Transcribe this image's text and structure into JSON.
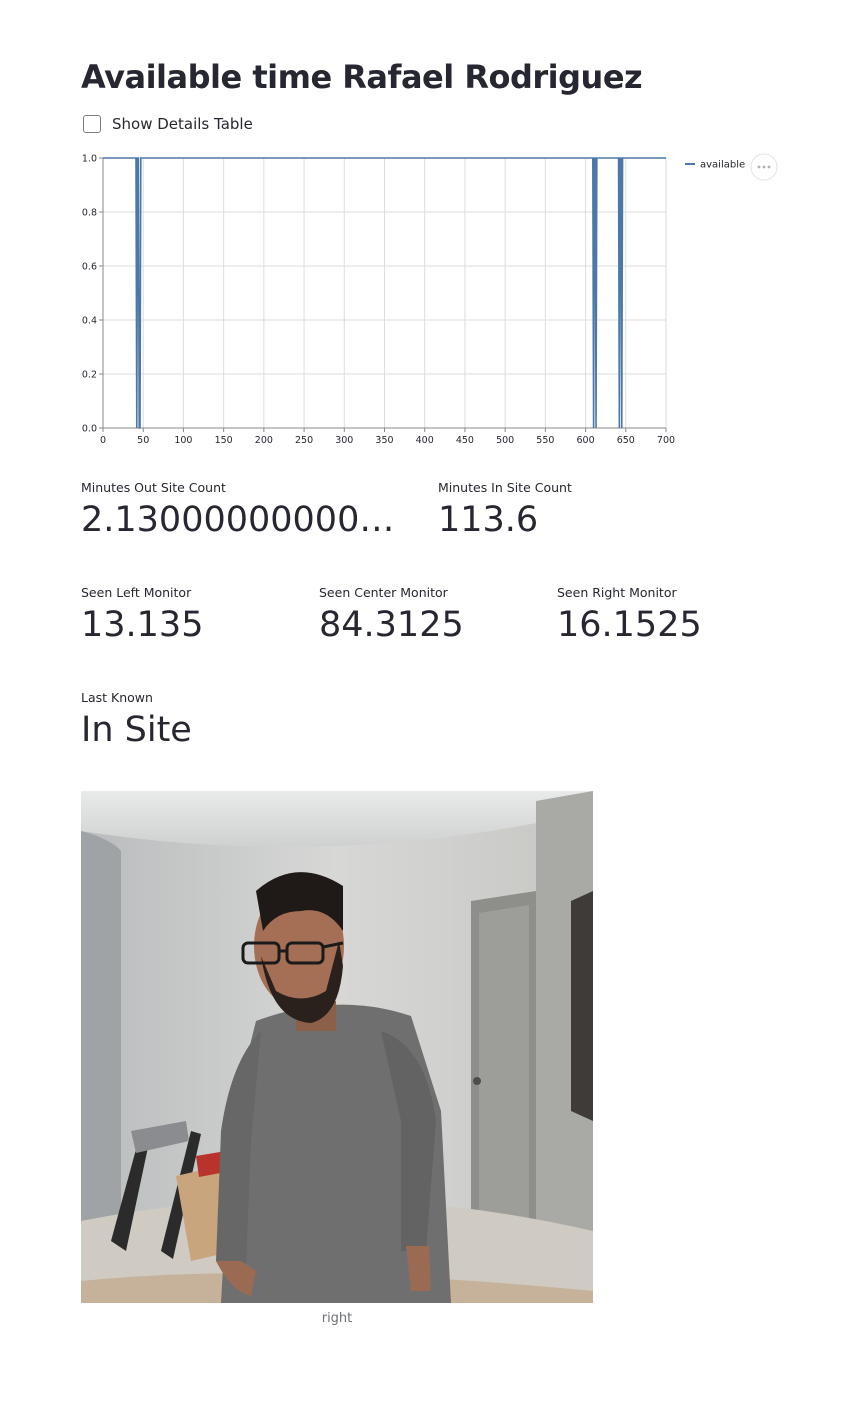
{
  "page": {
    "title": "Available time Rafael Rodriguez"
  },
  "controls": {
    "show_details_label": "Show Details Table",
    "show_details_checked": false
  },
  "chart_data": {
    "type": "line",
    "series": [
      {
        "name": "available",
        "color": "#4c78a8",
        "points": [
          [
            0,
            1
          ],
          [
            41,
            1
          ],
          [
            42,
            0
          ],
          [
            43,
            1
          ],
          [
            44,
            1
          ],
          [
            45,
            0
          ],
          [
            46,
            0
          ],
          [
            47,
            1
          ],
          [
            609,
            1
          ],
          [
            610,
            0
          ],
          [
            611,
            1
          ],
          [
            612,
            1
          ],
          [
            613,
            0
          ],
          [
            614,
            1
          ],
          [
            641,
            1
          ],
          [
            642,
            0
          ],
          [
            643,
            1
          ],
          [
            644,
            1
          ],
          [
            645,
            0
          ],
          [
            646,
            1
          ],
          [
            700,
            1
          ]
        ]
      }
    ],
    "x_ticks": [
      "0",
      "50",
      "100",
      "150",
      "200",
      "250",
      "300",
      "350",
      "400",
      "450",
      "500",
      "550",
      "600",
      "650",
      "700"
    ],
    "y_ticks": [
      "0.0",
      "0.2",
      "0.4",
      "0.6",
      "0.8",
      "1.0"
    ],
    "xlim": [
      0,
      700
    ],
    "ylim": [
      0,
      1
    ],
    "grid": true,
    "legend": "top-right",
    "xlabel": "",
    "ylabel": ""
  },
  "metrics_row1": [
    {
      "label": "Minutes Out Site Count",
      "value": "2.130000000000..."
    },
    {
      "label": "Minutes In Site Count",
      "value": "113.6"
    }
  ],
  "metrics_row2": [
    {
      "label": "Seen Left Monitor",
      "value": "13.135"
    },
    {
      "label": "Seen Center Monitor",
      "value": "84.3125"
    },
    {
      "label": "Seen Right Monitor",
      "value": "16.1525"
    }
  ],
  "last_known": {
    "label": "Last Known",
    "value": "In Site"
  },
  "image": {
    "caption": "right"
  }
}
